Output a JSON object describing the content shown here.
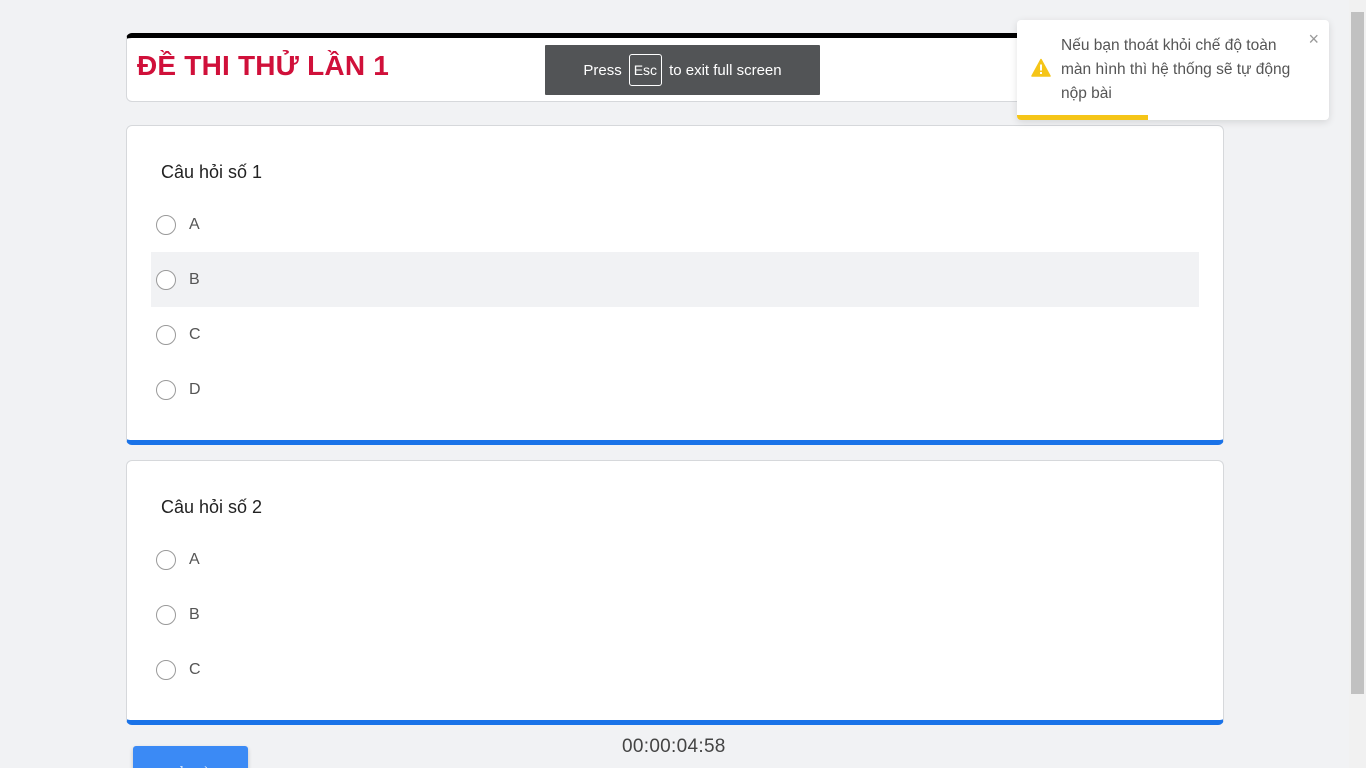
{
  "exam": {
    "title": "ĐỀ THI THỬ LẦN 1"
  },
  "fullscreen_notice": {
    "before": "Press",
    "key": "Esc",
    "after": "to exit full screen"
  },
  "questions": [
    {
      "title": "Câu hỏi số 1",
      "options": [
        "A",
        "B",
        "C",
        "D"
      ]
    },
    {
      "title": "Câu hỏi số 2",
      "options": [
        "A",
        "B",
        "C"
      ]
    }
  ],
  "toast": {
    "message": "Nếu bạn thoát khỏi chế độ toàn màn hình thì hệ thống sẽ tự động nộp bài",
    "close": "×",
    "icon": "warning-icon",
    "accent": "#f5c518",
    "progress": 0.42
  },
  "timer": "00:00:04:58",
  "submit_button": {
    "label": "GỬI BÀI"
  },
  "colors": {
    "title": "#d0103a",
    "card_accent": "#1a73e8",
    "button": "#3b8af5"
  }
}
